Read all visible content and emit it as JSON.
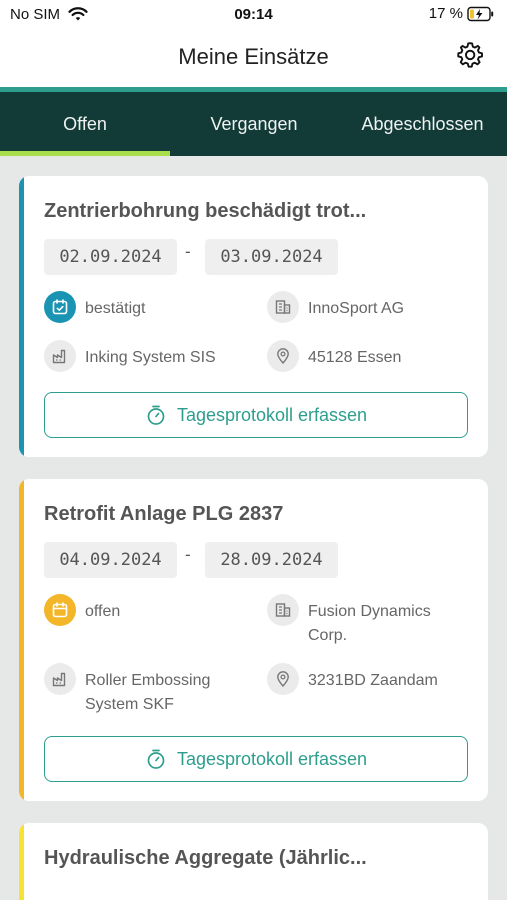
{
  "status": {
    "carrier": "No SIM",
    "time": "09:14",
    "battery": "17 %"
  },
  "header": {
    "title": "Meine Einsätze"
  },
  "tabs": [
    {
      "label": "Offen",
      "active": true
    },
    {
      "label": "Vergangen",
      "active": false
    },
    {
      "label": "Abgeschlossen",
      "active": false
    }
  ],
  "cta_label": "Tagesprotokoll erfassen",
  "jobs": [
    {
      "title": "Zentrierbohrung beschädigt trot...",
      "date_from": "02.09.2024",
      "date_to": "03.09.2024",
      "status": "bestätigt",
      "status_color": "#1b94b4",
      "customer": "InnoSport AG",
      "machine": "Inking System SIS",
      "location": "45128 Essen",
      "accent": "#1b94b4"
    },
    {
      "title": "Retrofit Anlage PLG 2837",
      "date_from": "04.09.2024",
      "date_to": "28.09.2024",
      "status": "offen",
      "status_color": "#f3b628",
      "customer_lines": [
        "Fusion Dynamics",
        "Corp."
      ],
      "machine_lines": [
        "Roller Embossing",
        "System SKF"
      ],
      "location": "3231BD Zaandam",
      "accent": "#f3b628"
    },
    {
      "title": "Hydraulische Aggregate (Jährlic...",
      "accent": "#f7e234"
    }
  ],
  "icons": {
    "wifi": "wifi-icon",
    "battery": "battery-charging-icon",
    "settings": "gear-icon",
    "calendar": "calendar-check-icon",
    "company": "building-icon",
    "machine": "factory-icon",
    "location": "location-pin-icon",
    "timer": "stopwatch-icon"
  }
}
